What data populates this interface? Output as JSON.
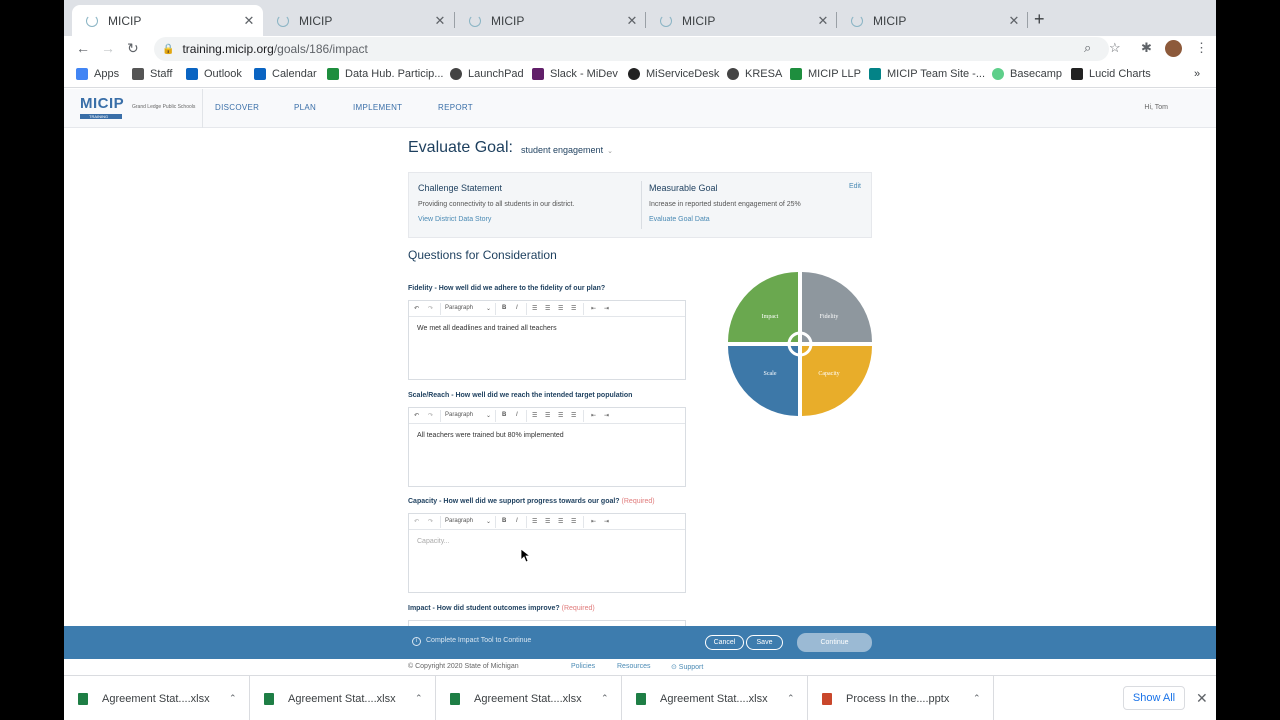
{
  "browser": {
    "tabs": [
      {
        "title": "MICIP",
        "active": true
      },
      {
        "title": "MICIP",
        "active": false
      },
      {
        "title": "MICIP",
        "active": false
      },
      {
        "title": "MICIP",
        "active": false
      },
      {
        "title": "MICIP",
        "active": false
      }
    ],
    "url_host": "training.micip.org",
    "url_path": "/goals/186/impact",
    "bookmarks": [
      "Apps",
      "Staff",
      "Outlook",
      "Calendar",
      "Data Hub. Particip...",
      "LaunchPad",
      "Slack - MiDev",
      "MiServiceDesk",
      "KRESA",
      "MICIP LLP",
      "MICIP Team Site -...",
      "Basecamp",
      "Lucid Charts"
    ],
    "bookmarks_more": "»"
  },
  "app": {
    "logo_text": "MICIP",
    "logo_sub": "TRAINING",
    "district": "Grand Ledge Public Schools",
    "nav": [
      "DISCOVER",
      "PLAN",
      "IMPLEMENT",
      "REPORT"
    ],
    "user_greeting": "Hi, Tom"
  },
  "page": {
    "title": "Evaluate Goal:",
    "goal_selected": "student engagement",
    "challenge": {
      "title": "Challenge Statement",
      "text": "Providing connectivity to all students in our district.",
      "link": "View District Data Story"
    },
    "measurable": {
      "title": "Measurable Goal",
      "text": "Increase in reported student engagement of 25%",
      "link": "Evaluate Goal Data",
      "edit": "Edit"
    },
    "questions_heading": "Questions for Consideration",
    "editor_format": "Paragraph",
    "questions": [
      {
        "label": "Fidelity - How well did we adhere to the fidelity of our plan?",
        "required": "",
        "answer": "We met all deadlines and trained all teachers",
        "placeholder": ""
      },
      {
        "label": "Scale/Reach - How well did we reach the intended target population",
        "required": "",
        "answer": "All teachers were trained but 80% implemented",
        "placeholder": ""
      },
      {
        "label": "Capacity - How well did we support progress towards our goal?",
        "required": "(Required)",
        "answer": "",
        "placeholder": "Capacity..."
      },
      {
        "label": "Impact - How did student outcomes improve?",
        "required": "(Required)",
        "answer": "",
        "placeholder": ""
      }
    ],
    "wheel": {
      "quadrants": [
        {
          "label": "Impact",
          "color": "#6aa84f"
        },
        {
          "label": "Fidelity",
          "color": "#8e979e"
        },
        {
          "label": "Scale",
          "color": "#3d78a8"
        },
        {
          "label": "Capacity",
          "color": "#e8ad2a"
        }
      ]
    }
  },
  "footer": {
    "info": "Complete Impact Tool to Continue",
    "cancel": "Cancel",
    "save": "Save",
    "continue": "Continue",
    "copyright": "© Copyright 2020 State of Michigan",
    "links": [
      "Policies",
      "Resources",
      "⊙ Support"
    ]
  },
  "downloads": {
    "items": [
      {
        "name": "Agreement Stat....xlsx",
        "color": "#1e7e45"
      },
      {
        "name": "Agreement Stat....xlsx",
        "color": "#1e7e45"
      },
      {
        "name": "Agreement Stat....xlsx",
        "color": "#1e7e45"
      },
      {
        "name": "Agreement Stat....xlsx",
        "color": "#1e7e45"
      },
      {
        "name": "Process In the....pptx",
        "color": "#c9472b"
      }
    ],
    "show_all": "Show All"
  }
}
